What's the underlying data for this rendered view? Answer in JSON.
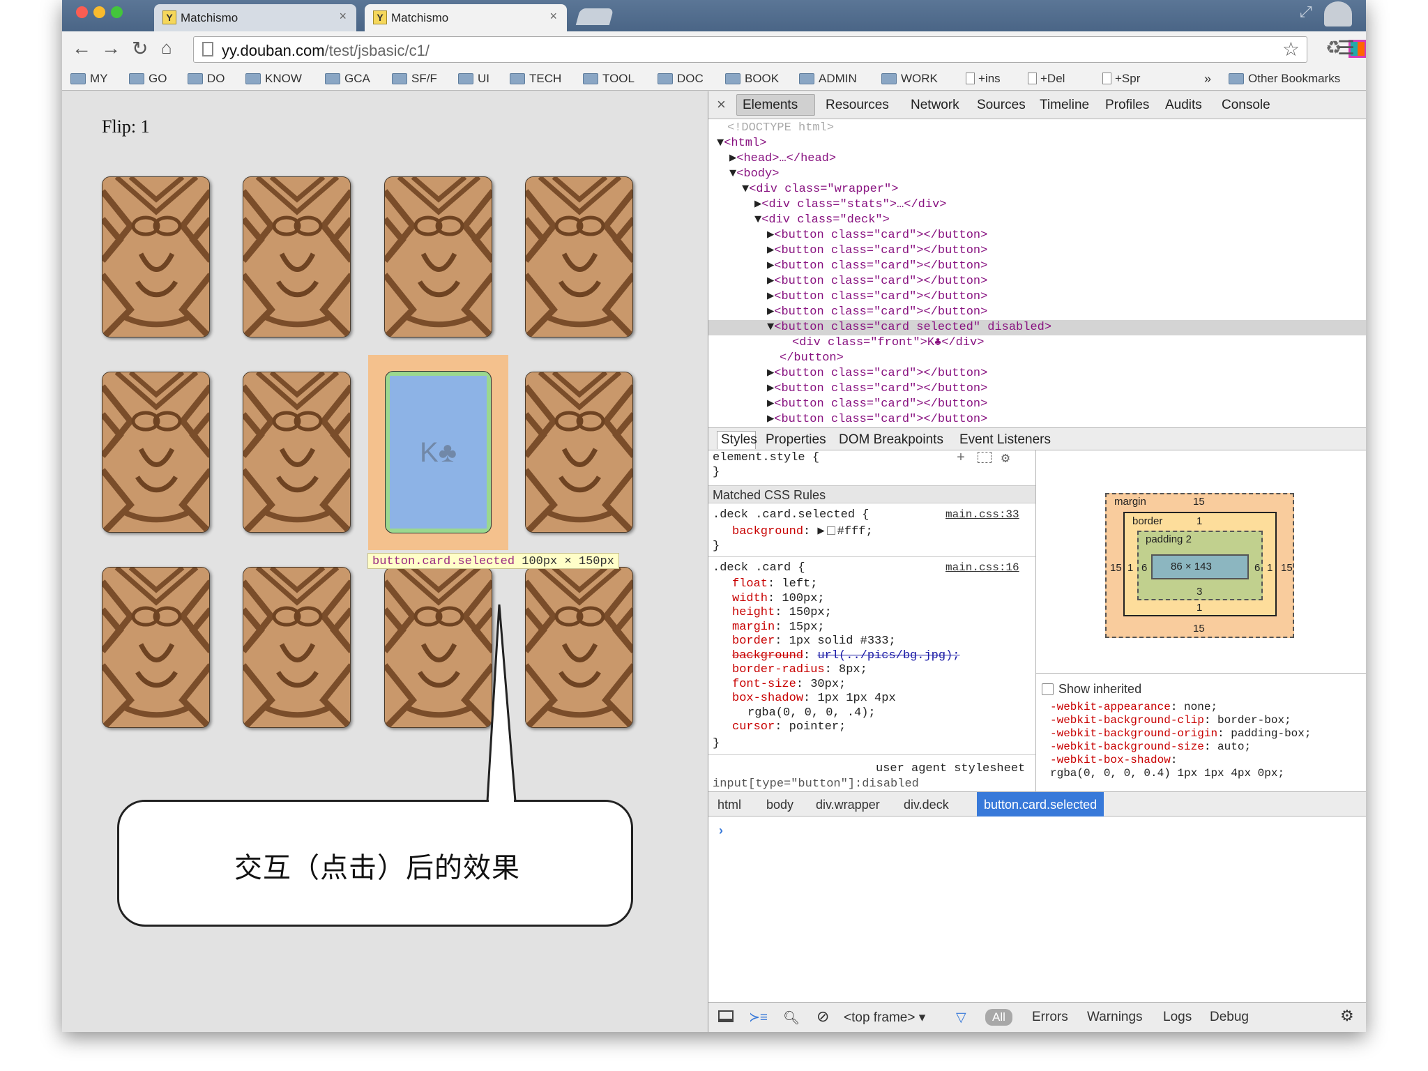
{
  "browser": {
    "tabs": [
      {
        "title": "Matchismo",
        "favicon": "Y",
        "close": "×"
      },
      {
        "title": "Matchismo",
        "favicon": "Y",
        "close": "×"
      }
    ],
    "url_host": "yy.douban.com",
    "url_path": "/test/jsbasic/c1/",
    "bookmarks": [
      "MY",
      "GO",
      "DO",
      "KNOW",
      "GCA",
      "SF/F",
      "UI",
      "TECH",
      "TOOL",
      "DOC",
      "BOOK",
      "ADMIN",
      "WORK",
      "+ins",
      "+Spr",
      "+Del"
    ],
    "bookmarks_overflow": "»",
    "other_bookmarks": "Other Bookmarks"
  },
  "game": {
    "flip_label": "Flip: 1",
    "selected_card": "K♣",
    "hover_tooltip": {
      "selector": "button.card.selected",
      "dimensions": "100px × 150px"
    }
  },
  "callout": {
    "text": "交互（点击）后的效果"
  },
  "devtools": {
    "tabs": [
      "Elements",
      "Resources",
      "Network",
      "Sources",
      "Timeline",
      "Profiles",
      "Audits",
      "Console"
    ],
    "active_tab": "Elements",
    "dom": {
      "doctype": "<!DOCTYPE html>",
      "html": "<html>",
      "head": "<head>…</head>",
      "body": "<body>",
      "wrapper": "<div class=\"wrapper\">",
      "stats": "<div class=\"stats\">…</div>",
      "deck": "<div class=\"deck\">",
      "card_line": "<button class=\"card\"></button>",
      "selected_line": "<button class=\"card selected\" disabled>",
      "front_line": "<div class=\"front\">K♣</div>",
      "close_button": "</button>"
    },
    "subtabs": [
      "Styles",
      "Properties",
      "DOM Breakpoints",
      "Event Listeners"
    ],
    "styles": {
      "element_style": "element.style {",
      "close": "}",
      "matched_header": "Matched CSS Rules",
      "rule1_selector": ".deck .card.selected {",
      "rule1_source": "main.css:33",
      "rule1_prop": "background",
      "rule1_val": "#fff;",
      "rule2_selector": ".deck .card {",
      "rule2_source": "main.css:16",
      "rule2_props": [
        {
          "name": "float",
          "value": "left;"
        },
        {
          "name": "width",
          "value": "100px;"
        },
        {
          "name": "height",
          "value": "150px;"
        },
        {
          "name": "margin",
          "value": "15px;"
        },
        {
          "name": "border",
          "value": "1px solid #333;"
        },
        {
          "name": "background",
          "value": "url(../pics/bg.jpg);"
        },
        {
          "name": "border-radius",
          "value": "8px;"
        },
        {
          "name": "font-size",
          "value": "30px;"
        },
        {
          "name": "box-shadow",
          "value": "1px 1px 4px"
        },
        {
          "name": "",
          "value": "rgba(0, 0, 0, .4);"
        },
        {
          "name": "cursor",
          "value": "pointer;"
        }
      ],
      "user_agent": "user agent stylesheet",
      "ua_selector": "input[type=\"button\"]:disabled"
    },
    "box_model": {
      "margin_label": "margin",
      "margin": "15",
      "border_label": "border",
      "border": "1",
      "padding_label": "padding",
      "padding": "2",
      "content": "86 × 143",
      "padding_side": "6",
      "padding_bottom": "3",
      "border_bottom": "1",
      "margin_bottom": "15"
    },
    "computed": {
      "show_inherited": "Show inherited",
      "props": [
        {
          "name": "-webkit-appearance",
          "value": "none;"
        },
        {
          "name": "-webkit-background-clip",
          "value": "border-box;"
        },
        {
          "name": "-webkit-background-origin",
          "value": "padding-box;"
        },
        {
          "name": "-webkit-background-size",
          "value": "auto;"
        },
        {
          "name": "-webkit-box-shadow",
          "value": ""
        },
        {
          "name": "",
          "value": "rgba(0, 0, 0, 0.4) 1px 1px 4px 0px;"
        }
      ]
    },
    "breadcrumbs": [
      "html",
      "body",
      "div.wrapper",
      "div.deck",
      "button.card.selected"
    ],
    "console_prompt": "›",
    "frame_select": "<top frame>",
    "filters": [
      "All",
      "Errors",
      "Warnings",
      "Logs",
      "Debug"
    ]
  },
  "colors": {
    "selection_blue": "#3879d9",
    "card_back": "#c08e60",
    "highlight_margin": "#f4c18d",
    "highlight_padding": "#9bd88e",
    "highlight_content": "#8db3e6"
  }
}
